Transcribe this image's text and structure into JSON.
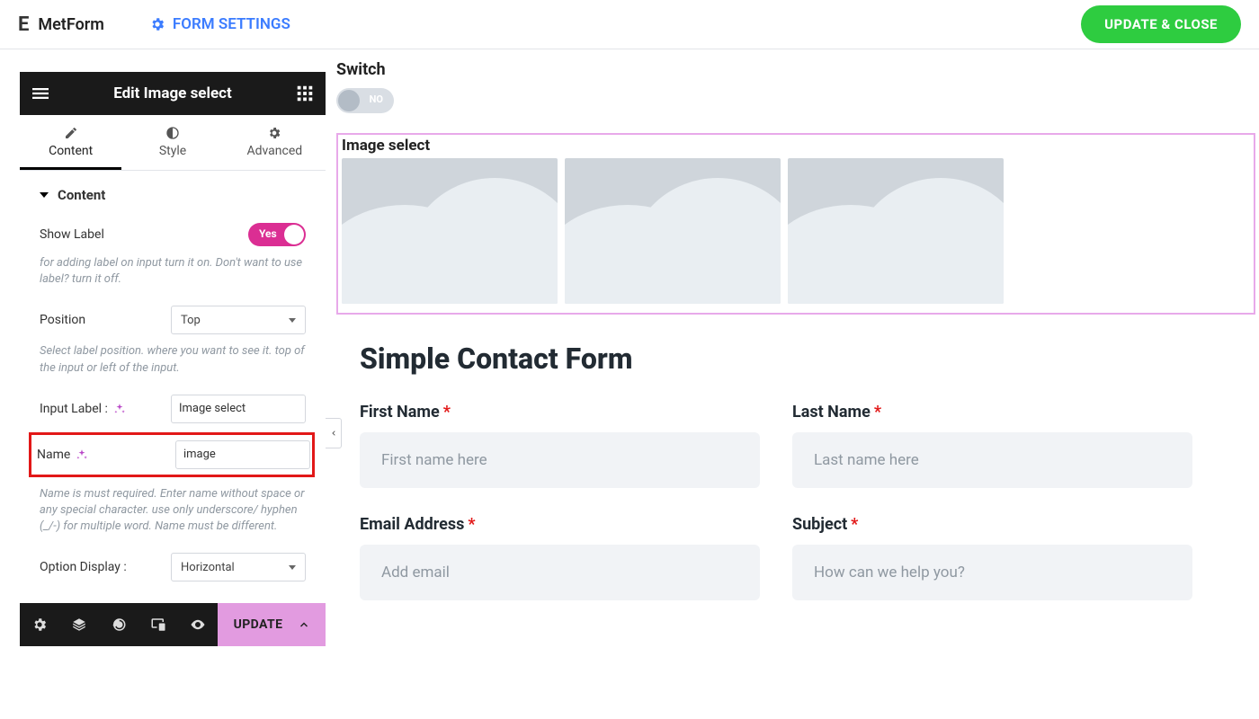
{
  "header": {
    "brand_logo": "E",
    "brand": "MetForm",
    "form_settings": "FORM SETTINGS",
    "update_close": "UPDATE & CLOSE"
  },
  "panel": {
    "title": "Edit Image select",
    "tabs": {
      "content": "Content",
      "style": "Style",
      "advanced": "Advanced"
    },
    "section": "Content",
    "show_label": {
      "label": "Show Label",
      "toggle_text": "Yes",
      "help": "for adding label on input turn it on. Don't want to use label? turn it off."
    },
    "position": {
      "label": "Position",
      "value": "Top",
      "help": "Select label position. where you want to see it. top of the input or left of the input."
    },
    "input_label": {
      "label": "Input Label :",
      "value": "Image select"
    },
    "name": {
      "label": "Name",
      "value": "image",
      "help": "Name is must required. Enter name without space or any special character. use only underscore/ hyphen (_/-) for multiple word. Name must be different."
    },
    "option_display": {
      "label": "Option Display :",
      "value": "Horizontal"
    },
    "footer": {
      "update": "UPDATE"
    }
  },
  "canvas": {
    "switch": {
      "label": "Switch",
      "state_text": "NO"
    },
    "image_select": {
      "label": "Image select"
    },
    "form": {
      "title": "Simple Contact Form",
      "first_name": {
        "label": "First Name",
        "placeholder": "First name here"
      },
      "last_name": {
        "label": "Last Name",
        "placeholder": "Last name here"
      },
      "email": {
        "label": "Email Address",
        "placeholder": "Add email"
      },
      "subject": {
        "label": "Subject",
        "placeholder": "How can we help you?"
      }
    }
  }
}
